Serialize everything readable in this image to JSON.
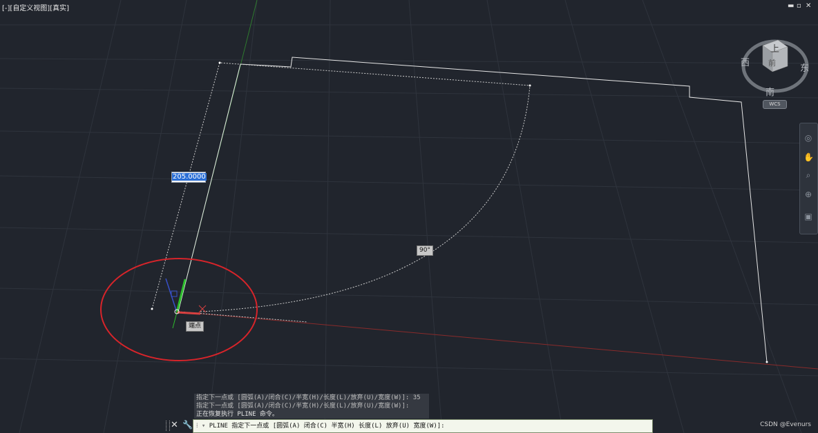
{
  "viewport": {
    "label": "[-][自定义视图][真实]",
    "controls": {
      "minimize": "▬",
      "restore": "▫",
      "close": "✕"
    }
  },
  "dynamic_input": {
    "value": "205.0000"
  },
  "angle_tooltip": {
    "text": "90°"
  },
  "snap_tooltip": {
    "text": "端点"
  },
  "viewcube": {
    "top_face": "上",
    "front_face": "前",
    "north": "",
    "west": "西",
    "east": "东",
    "south": "南",
    "wcs_label": "WCS"
  },
  "nav_bar": {
    "icons": [
      "steering-wheel-icon",
      "pan-hand-icon",
      "zoom-icon",
      "orbit-icon",
      "showmotion-icon"
    ]
  },
  "command": {
    "history": [
      "指定下一点或 [圆弧(A)/闭合(C)/半宽(H)/长度(L)/放弃(U)/宽度(W)]: 35",
      "指定下一点或 [圆弧(A)/闭合(C)/半宽(H)/长度(L)/放弃(U)/宽度(W)]:",
      "正在恢复执行 PLINE 命令。"
    ],
    "prompt_prefix": "⁞ ▾",
    "prompt": "PLINE 指定下一点或 [圆弧(A) 闭合(C) 半宽(H) 长度(L) 放弃(U) 宽度(W)]:",
    "close_label": "✕",
    "customize_label": "🔧"
  },
  "watermark": "CSDN @Evenurs",
  "colors": {
    "background": "#21252d",
    "grid": "#2f343d",
    "x_axis": "#8a2b2b",
    "y_axis": "#2f7a2f",
    "annotation_circle": "#d8242a"
  }
}
